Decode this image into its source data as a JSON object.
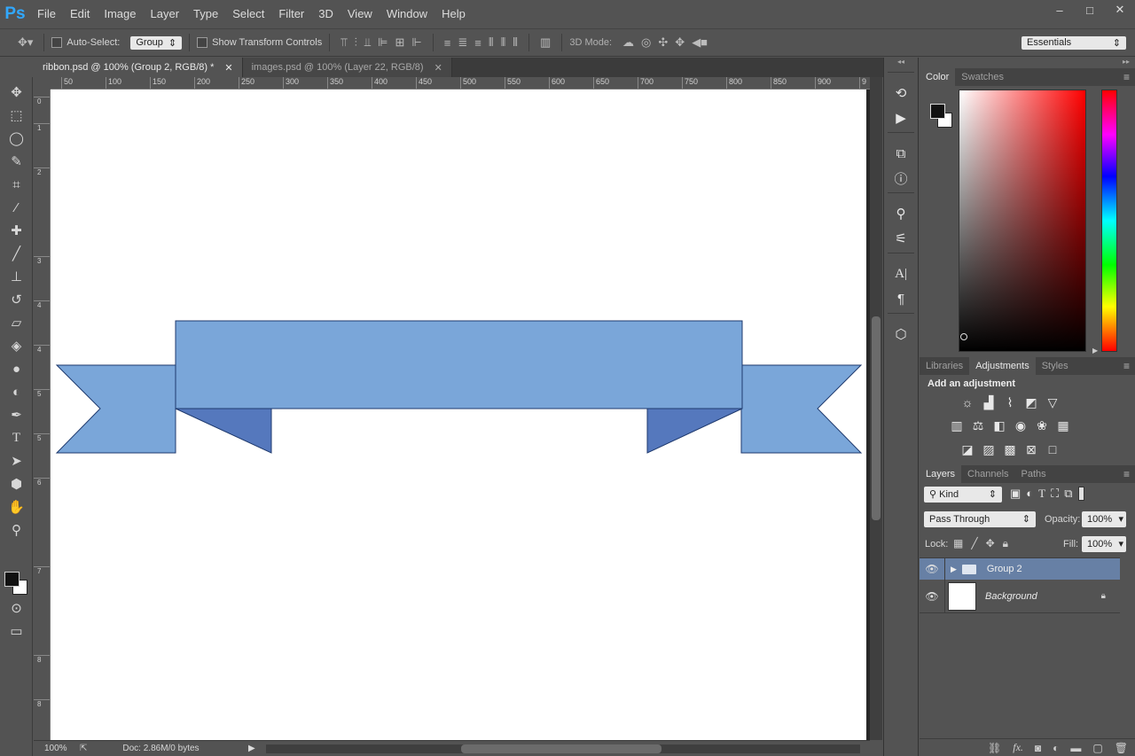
{
  "app": {
    "logo": "Ps"
  },
  "menu": [
    "File",
    "Edit",
    "Image",
    "Layer",
    "Type",
    "Select",
    "Filter",
    "3D",
    "View",
    "Window",
    "Help"
  ],
  "window_controls": {
    "minimize": "–",
    "maximize": "□",
    "close": "✕"
  },
  "options_bar": {
    "auto_select_label": "Auto-Select:",
    "auto_select_value": "Group",
    "transform_label": "Show Transform Controls",
    "mode_label": "3D Mode:",
    "workspace": "Essentials"
  },
  "tabs": [
    {
      "label": "ribbon.psd @ 100% (Group 2, RGB/8) *",
      "close": "✕"
    },
    {
      "label": "images.psd @ 100% (Layer 22, RGB/8)",
      "close": "✕"
    }
  ],
  "ruler": {
    "h": [
      "50",
      "100",
      "150",
      "200",
      "250",
      "300",
      "350",
      "400",
      "450",
      "500",
      "550",
      "600",
      "650",
      "700",
      "750",
      "800",
      "850",
      "900",
      "9"
    ],
    "v": [
      "0",
      "1",
      "2",
      "3",
      "4",
      "4",
      "5",
      "5",
      "6",
      "7",
      "8",
      "8"
    ]
  },
  "status": {
    "zoom": "100%",
    "doc": "Doc: 2.86M/0 bytes"
  },
  "ribbon": {
    "light_color": "#7aa6d9",
    "dark_color": "#5578bd",
    "outline_color": "#1f3a6e"
  },
  "color_panel": {
    "tabs": [
      "Color",
      "Swatches"
    ],
    "fg": "#1a1a1a",
    "bg": "#ffffff"
  },
  "adjust_panel": {
    "tabs": [
      "Libraries",
      "Adjustments",
      "Styles"
    ],
    "heading": "Add an adjustment"
  },
  "layers_panel": {
    "tabs": [
      "Layers",
      "Channels",
      "Paths"
    ],
    "filter": "Kind",
    "blend": "Pass Through",
    "opacity_label": "Opacity:",
    "opacity": "100%",
    "lock_label": "Lock:",
    "fill_label": "Fill:",
    "fill": "100%",
    "layers": [
      {
        "name": "Group 2"
      },
      {
        "name": "Background"
      }
    ]
  }
}
